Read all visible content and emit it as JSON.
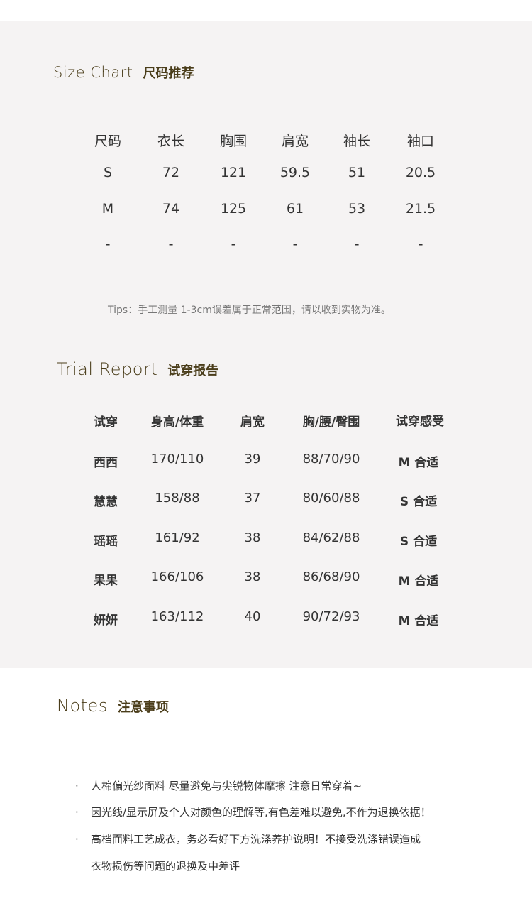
{
  "size_chart": {
    "title_en": "Size Chart",
    "title_zh": "尺码推荐",
    "headers": [
      "尺码",
      "衣长",
      "胸围",
      "肩宽",
      "袖长",
      "袖口"
    ],
    "rows": [
      [
        "S",
        "72",
        "121",
        "59.5",
        "51",
        "20.5"
      ],
      [
        "M",
        "74",
        "125",
        "61",
        "53",
        "21.5"
      ],
      [
        "-",
        "-",
        "-",
        "-",
        "-",
        "-"
      ]
    ],
    "tips": "Tips：手工测量 1-3cm误差属于正常范围，请以收到实物为准。"
  },
  "trial_report": {
    "title_en": "Trial Report",
    "title_zh": "试穿报告",
    "headers": [
      "试穿",
      "身高/体重",
      "肩宽",
      "胸/腰/臀围",
      "试穿感受"
    ],
    "rows": [
      [
        "西西",
        "170/110",
        "39",
        "88/70/90",
        "M 合适"
      ],
      [
        "慧慧",
        "158/88",
        "37",
        "80/60/88",
        "S 合适"
      ],
      [
        "瑶瑶",
        "161/92",
        "38",
        "84/62/88",
        "S 合适"
      ],
      [
        "果果",
        "166/106",
        "38",
        "86/68/90",
        "M 合适"
      ],
      [
        "妍妍",
        "163/112",
        "40",
        "90/72/93",
        "M 合适"
      ]
    ]
  },
  "notes": {
    "title_en": "Notes",
    "title_zh": "注意事项",
    "bullet": "·",
    "items": [
      "人棉偏光纱面料 尽量避免与尖锐物体摩擦 注意日常穿着~",
      "因光线/显示屏及个人对颜色的理解等,有色差难以避免,不作为退换依据！",
      "高档面料工艺成衣，务必看好下方洗涤养护说明！不接受洗涤错误造成"
    ],
    "item3_continuation": "衣物损伤等问题的退换及中差评"
  }
}
